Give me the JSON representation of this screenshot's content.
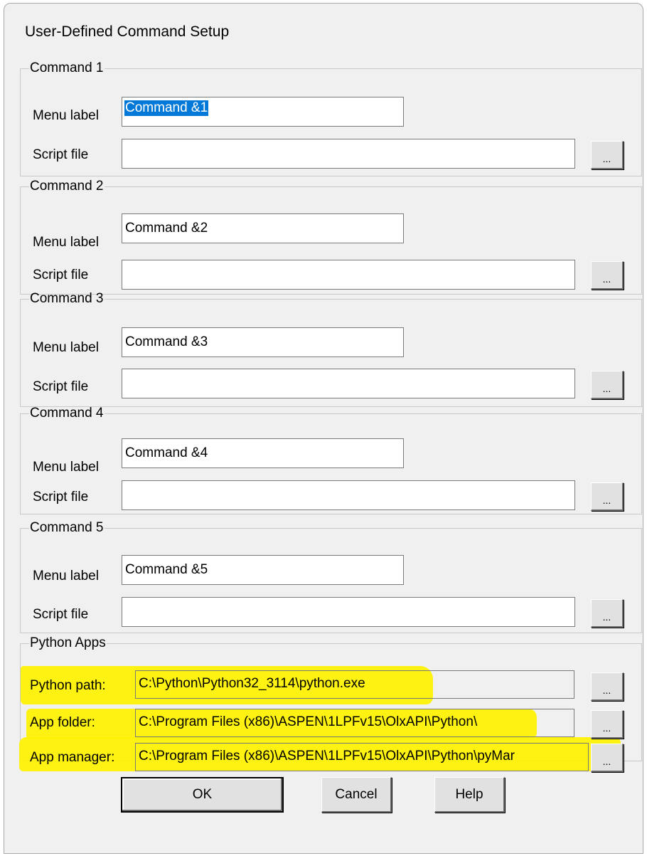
{
  "dialog": {
    "title": "User-Defined Command Setup"
  },
  "labels": {
    "menu_label": "Menu label",
    "script_file": "Script file",
    "browse": "..."
  },
  "commands": [
    {
      "legend": "Command 1",
      "menu_label_value": "Command &1",
      "script_file_value": ""
    },
    {
      "legend": "Command 2",
      "menu_label_value": "Command &2",
      "script_file_value": ""
    },
    {
      "legend": "Command 3",
      "menu_label_value": "Command &3",
      "script_file_value": ""
    },
    {
      "legend": "Command 4",
      "menu_label_value": "Command &4",
      "script_file_value": ""
    },
    {
      "legend": "Command 5",
      "menu_label_value": "Command &5",
      "script_file_value": ""
    }
  ],
  "python_apps": {
    "legend": "Python Apps",
    "python_path_label": "Python path:",
    "python_path_value": "C:\\Python\\Python32_3114\\python.exe",
    "app_folder_label": "App folder:",
    "app_folder_value": "C:\\Program Files (x86)\\ASPEN\\1LPFv15\\OlxAPI\\Python\\",
    "app_manager_label": "App manager:",
    "app_manager_value": "C:\\Program Files (x86)\\ASPEN\\1LPFv15\\OlxAPI\\Python\\pyMar",
    "highlight_color": "#fff200"
  },
  "buttons": {
    "ok": "OK",
    "cancel": "Cancel",
    "help": "Help"
  },
  "colors": {
    "selection": "#0078d7",
    "dialog_bg": "#f0f0f0"
  }
}
